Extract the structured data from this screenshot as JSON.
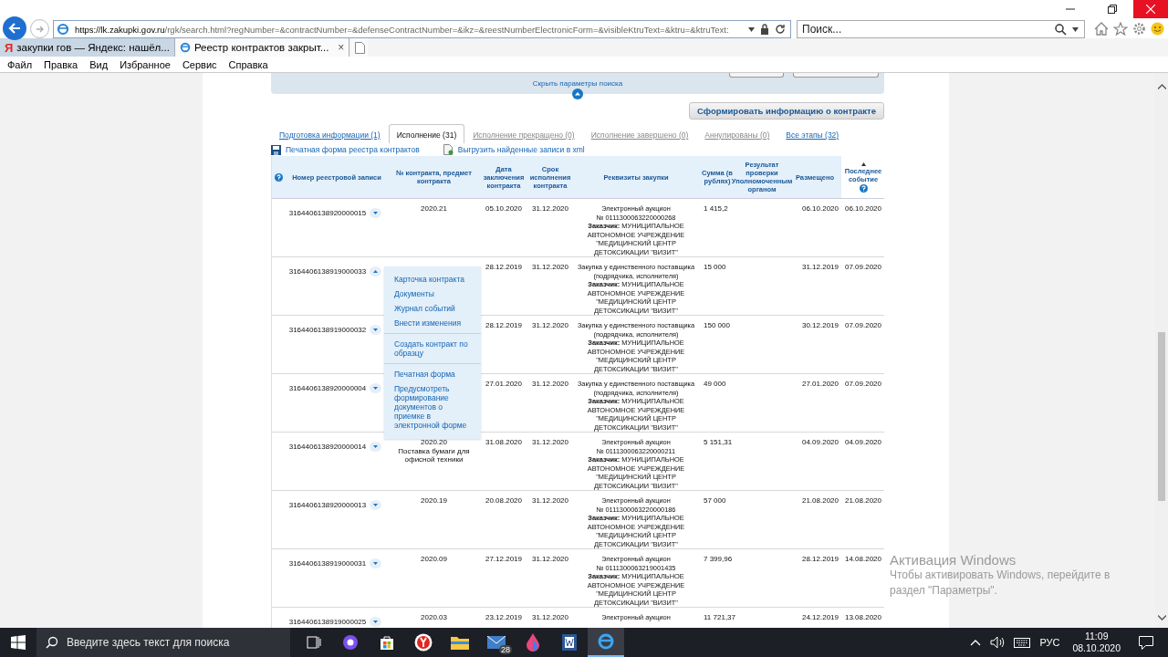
{
  "browser": {
    "url_host": "https://lk.zakupki.gov.ru",
    "url_path": "/rgk/search.html?regNumber=&contractNumber=&defenseContractNumber=&ikz=&reestNumberElectronicForm=&visibleKtruText=&ktru=&ktruText:",
    "search_placeholder": "Поиск...",
    "tabs": [
      {
        "icon_text": "Я",
        "label": "закупки гов — Яндекс: нашёл...",
        "selected": false
      },
      {
        "label": "Реестр контрактов закрыт...",
        "close": "×",
        "selected": true
      }
    ],
    "menu": [
      "Файл",
      "Правка",
      "Вид",
      "Избранное",
      "Сервис",
      "Справка"
    ]
  },
  "search_panel": {
    "toggle_link": "Скрыть параметры поиска"
  },
  "generate_button": "Сформировать информацию о контракте",
  "tabs": [
    {
      "label": "Подготовка информации (1)",
      "selected": false,
      "disabled": false
    },
    {
      "label": "Исполнение (31)",
      "selected": true,
      "disabled": false
    },
    {
      "label": "Исполнение прекращено (0)",
      "selected": false,
      "disabled": true
    },
    {
      "label": "Исполнение завершено (0)",
      "selected": false,
      "disabled": true
    },
    {
      "label": "Аннулированы (0)",
      "selected": false,
      "disabled": true
    },
    {
      "label": "Все этапы (32)",
      "selected": false,
      "disabled": false
    }
  ],
  "actions": [
    {
      "kind": "save",
      "label": "Печатная форма реестра контрактов"
    },
    {
      "kind": "export",
      "label": "Выгрузить найденные записи в xml"
    }
  ],
  "table": {
    "columns": [
      "Номер реестровой записи",
      "№ контракта, предмет контракта",
      "Дата заключения контракта",
      "Срок исполнения контракта",
      "Реквизиты закупки",
      "Сумма (в рублях)",
      "Результат проверки Уполномоченным органом",
      "Размещено",
      "Последнее событие"
    ],
    "rows": [
      {
        "reg": "3164406138920000015",
        "expanded": false,
        "contract": [
          "2020.21"
        ],
        "date": "05.10.2020",
        "term": "31.12.2020",
        "purchase": [
          "Электронный аукцион",
          "№ 0111300063220000268"
        ],
        "customer": "**Заказчик:** МУНИЦИПАЛЬНОЕ АВТОНОМНОЕ УЧРЕЖДЕНИЕ \"МЕДИЦИНСКИЙ ЦЕНТР ДЕТОКСИКАЦИИ \"ВИЗИТ\"",
        "sum": "1 415,2",
        "placed": "06.10.2020",
        "last": "06.10.2020"
      },
      {
        "reg": "3164406138919000033",
        "expanded": true,
        "date": "28.12.2019",
        "term": "31.12.2020",
        "purchase": [
          "Закупка у единственного поставщика (подрядчика, исполнителя)"
        ],
        "customer": "**Заказчик:** МУНИЦИПАЛЬНОЕ АВТОНОМНОЕ УЧРЕЖДЕНИЕ \"МЕДИЦИНСКИЙ ЦЕНТР ДЕТОКСИКАЦИИ \"ВИЗИТ\"",
        "sum": "15 000",
        "placed": "31.12.2019",
        "last": "07.09.2020"
      },
      {
        "reg": "3164406138919000032",
        "expanded": false,
        "date": "28.12.2019",
        "term": "31.12.2020",
        "purchase": [
          "Закупка у единственного поставщика (подрядчика, исполнителя)"
        ],
        "customer": "**Заказчик:** МУНИЦИПАЛЬНОЕ АВТОНОМНОЕ УЧРЕЖДЕНИЕ \"МЕДИЦИНСКИЙ ЦЕНТР ДЕТОКСИКАЦИИ \"ВИЗИТ\"",
        "sum": "150 000",
        "placed": "30.12.2019",
        "last": "07.09.2020"
      },
      {
        "reg": "3164406138920000004",
        "expanded": false,
        "date": "27.01.2020",
        "term": "31.12.2020",
        "purchase": [
          "Закупка у единственного поставщика (подрядчика, исполнителя)"
        ],
        "customer": "**Заказчик:** МУНИЦИПАЛЬНОЕ АВТОНОМНОЕ УЧРЕЖДЕНИЕ \"МЕДИЦИНСКИЙ ЦЕНТР ДЕТОКСИКАЦИИ \"ВИЗИТ\"",
        "sum": "49 000",
        "placed": "27.01.2020",
        "last": "07.09.2020"
      },
      {
        "reg": "3164406138920000014",
        "expanded": false,
        "contract": [
          "2020.20",
          "Поставка бумаги для офисной техники"
        ],
        "date": "31.08.2020",
        "term": "31.12.2020",
        "purchase": [
          "Электронный аукцион",
          "№ 0111300063220000211"
        ],
        "customer": "**Заказчик:** МУНИЦИПАЛЬНОЕ АВТОНОМНОЕ УЧРЕЖДЕНИЕ \"МЕДИЦИНСКИЙ ЦЕНТР ДЕТОКСИКАЦИИ \"ВИЗИТ\"",
        "sum": "5 151,31",
        "placed": "04.09.2020",
        "last": "04.09.2020"
      },
      {
        "reg": "3164406138920000013",
        "expanded": false,
        "contract": [
          "2020.19"
        ],
        "date": "20.08.2020",
        "term": "31.12.2020",
        "purchase": [
          "Электронный аукцион",
          "№ 0111300063220000186"
        ],
        "customer": "**Заказчик:** МУНИЦИПАЛЬНОЕ АВТОНОМНОЕ УЧРЕЖДЕНИЕ \"МЕДИЦИНСКИЙ ЦЕНТР ДЕТОКСИКАЦИИ \"ВИЗИТ\"",
        "sum": "57 000",
        "placed": "21.08.2020",
        "last": "21.08.2020"
      },
      {
        "reg": "3164406138919000031",
        "expanded": false,
        "contract": [
          "2020.09"
        ],
        "date": "27.12.2019",
        "term": "31.12.2020",
        "purchase": [
          "Электронный аукцион",
          "№ 0111300063219001435"
        ],
        "customer": "**Заказчик:** МУНИЦИПАЛЬНОЕ АВТОНОМНОЕ УЧРЕЖДЕНИЕ \"МЕДИЦИНСКИЙ ЦЕНТР ДЕТОКСИКАЦИИ \"ВИЗИТ\"",
        "sum": "7 399,96",
        "placed": "28.12.2019",
        "last": "14.08.2020"
      },
      {
        "reg": "3164406138919000025",
        "expanded": false,
        "contract": [
          "2020.03"
        ],
        "date": "23.12.2019",
        "term": "31.12.2020",
        "purchase": [
          "Электронный аукцион"
        ],
        "sum": "11 721,37",
        "placed": "24.12.2019",
        "last": "13.08.2020"
      }
    ]
  },
  "context_menu": {
    "groups": [
      [
        "Карточка контракта",
        "Документы",
        "Журнал событий",
        "Внести изменения"
      ],
      [
        "Создать контракт по образцу"
      ],
      [
        "Печатная форма",
        "Предусмотреть формирование документов о приемке в электронной форме"
      ]
    ]
  },
  "windows_activation": {
    "title": "Активация Windows",
    "text": "Чтобы активировать Windows, перейдите в раздел \"Параметры\"."
  },
  "taskbar": {
    "search_placeholder": "Введите здесь текст для поиска",
    "mail_badge": "28",
    "language": "РУС",
    "time": "11:09",
    "date": "08.10.2020"
  }
}
